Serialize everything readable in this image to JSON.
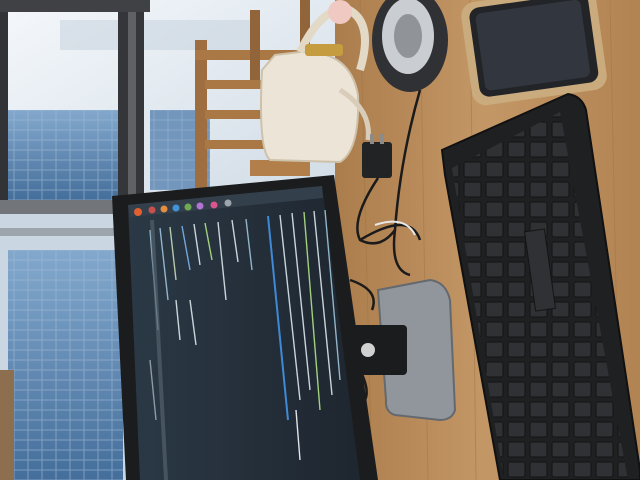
{
  "scene": {
    "type": "photograph",
    "subjects": [
      "monitor-with-terminal",
      "keyboard",
      "smartphone",
      "handbag",
      "chair",
      "window",
      "desk",
      "power-adapter",
      "cables",
      "speaker"
    ],
    "colors": {
      "desk": "#b98a55",
      "desk_dark": "#8e6237",
      "window_sky": "#e6eef5",
      "building_glass": "#5f89b6",
      "monitor_bezel": "#161719",
      "screen": "#1d2a34",
      "keyboard": "#1a1b1d",
      "bag": "#e9e1d2",
      "chair": "#9b6a3a"
    },
    "icons": {
      "speaker": "round-speaker-icon",
      "phone": "smartphone-icon",
      "adapter": "power-adapter-icon",
      "stand": "monitor-stand-icon"
    }
  }
}
